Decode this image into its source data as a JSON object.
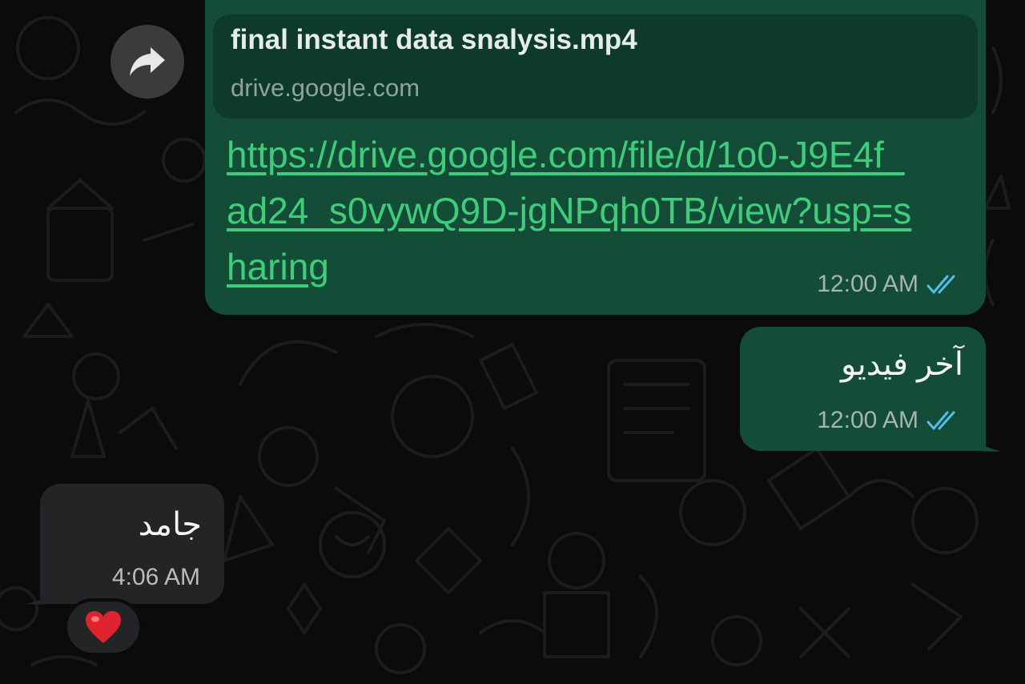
{
  "chat": {
    "outgoing_link_message": {
      "preview_title": "final instant data snalysis.mp4",
      "preview_domain": "drive.google.com",
      "url": "https://drive.google.com/file/d/1o0-J9E4f_ad24_s0vywQ9D-jgNPqh0TB/view?usp=sharing",
      "time": "12:00 AM",
      "status_icon": "double-check-read-icon"
    },
    "outgoing_text_message": {
      "text": "آخر فيديو",
      "time": "12:00 AM",
      "status_icon": "double-check-read-icon"
    },
    "incoming_text_message": {
      "text": "جامد",
      "time": "4:06 AM",
      "reaction": "❤️"
    }
  },
  "icons": {
    "forward": "forward-arrow-icon"
  },
  "colors": {
    "background": "#0b0b0b",
    "outgoing_bubble": "#144d37",
    "link_preview_bg": "#0d3a29",
    "incoming_bubble": "#232425",
    "link_color": "#3fcd7c",
    "read_ticks": "#53bdeb"
  }
}
